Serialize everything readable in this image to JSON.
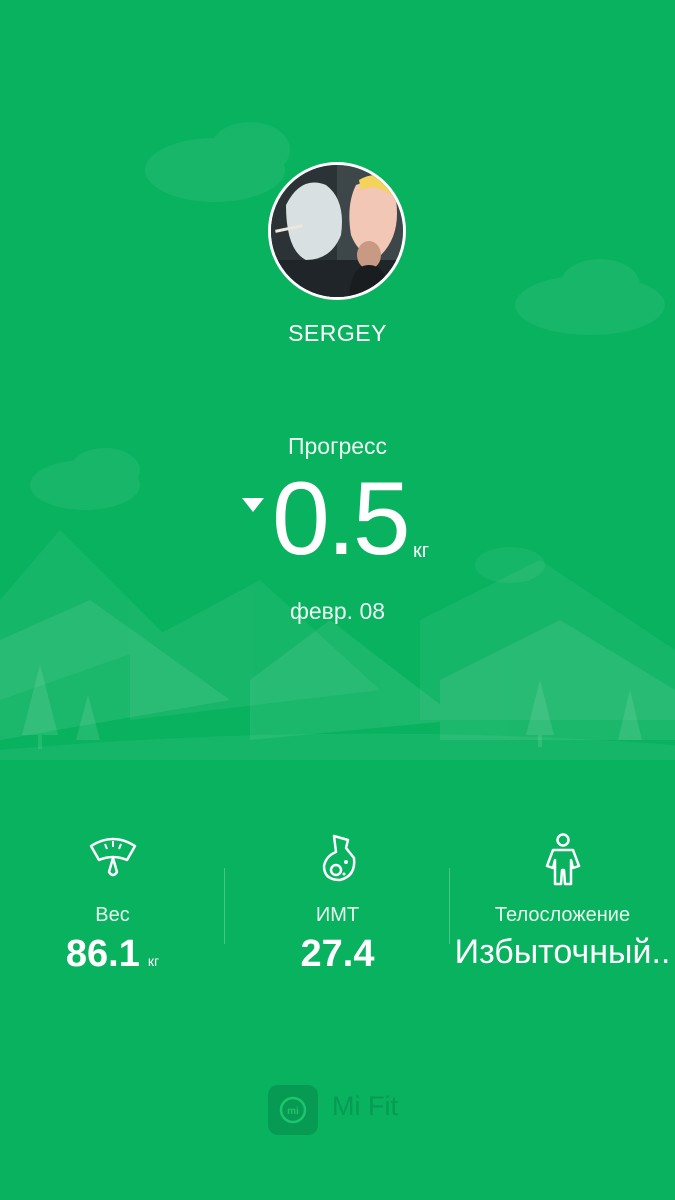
{
  "profile": {
    "name": "SERGEY"
  },
  "progress": {
    "label": "Прогресс",
    "direction": "down",
    "value": "0.5",
    "unit": "кг",
    "date": "февр. 08"
  },
  "stats": [
    {
      "icon": "scale-icon",
      "label": "Вес",
      "value": "86.1",
      "unit": "кг"
    },
    {
      "icon": "bmi-icon",
      "label": "ИМТ",
      "value": "27.4",
      "unit": ""
    },
    {
      "icon": "body-icon",
      "label": "Телосложение",
      "value": "Избыточный..",
      "unit": ""
    }
  ],
  "footer": {
    "logo_icon": "mi-logo-icon",
    "app_name": "Mi Fit"
  },
  "colors": {
    "background": "#08b25f",
    "mountains_light": "#2fc874",
    "footer_logo": "#079a52"
  }
}
